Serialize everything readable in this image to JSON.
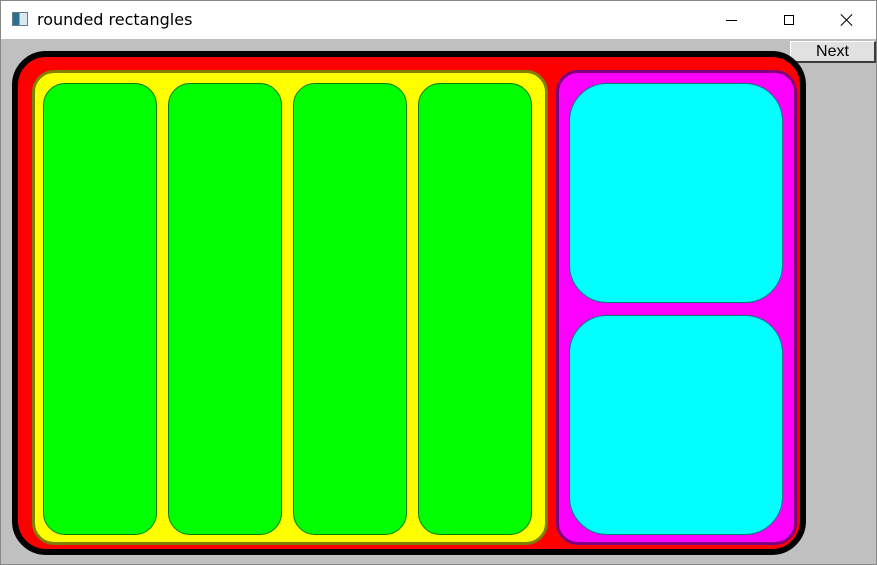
{
  "window": {
    "title": "rounded rectangles",
    "controls": {
      "minimize": "minimize-icon",
      "maximize": "maximize-icon",
      "close": "close-icon"
    }
  },
  "toolbar": {
    "next_label": "Next"
  },
  "canvas": {
    "outer_fill": "#ff0000",
    "outer_border": "#000000",
    "left_group": {
      "fill": "#ffff00",
      "border": "#7f7f00",
      "items": [
        "#00ff00",
        "#00ff00",
        "#00ff00",
        "#00ff00"
      ]
    },
    "right_group": {
      "fill": "#ff00ff",
      "border": "#7f007f",
      "items": [
        "#00ffff",
        "#00ffff"
      ]
    }
  }
}
